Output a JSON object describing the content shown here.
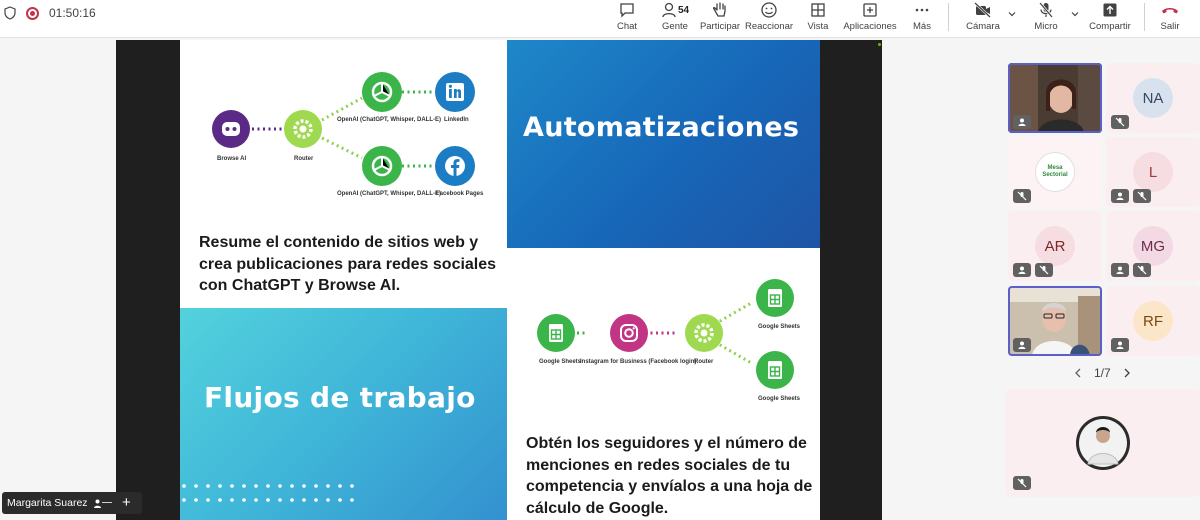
{
  "topbar": {
    "timer": "01:50:16",
    "people_count": "54",
    "buttons": {
      "chat": "Chat",
      "people": "Gente",
      "raise": "Participar",
      "react": "Reaccionar",
      "view": "Vista",
      "apps": "Aplicaciones",
      "more": "Más",
      "camera": "Cámara",
      "mic": "Micro",
      "share": "Compartir",
      "leave": "Salir"
    }
  },
  "slide": {
    "title_auto": "Automatizaciones",
    "title_flujos": "Flujos de trabajo",
    "text_1": "Resume el contenido de sitios web y crea publicaciones para redes sociales con ChatGPT y Browse AI.",
    "text_2": "Obtén los seguidores y el número de menciones en redes sociales de tu competencia y envíalos a una hoja de cálculo de Google.",
    "flow_1": {
      "browse": "Browse AI",
      "router": "Router",
      "openai_top": "OpenAI (ChatGPT, Whisper, DALL-E)",
      "openai_bottom": "OpenAI (ChatGPT, Whisper, DALL-E)",
      "linkedin": "LinkedIn",
      "facebook": "Facebook Pages"
    },
    "flow_2": {
      "sheets_left": "Google Sheets",
      "instagram": "Instagram for Business (Facebook login)",
      "router": "Router",
      "sheets_top": "Google Sheets",
      "sheets_bottom": "Google Sheets"
    }
  },
  "gallery": {
    "initials": [
      "NA",
      "L",
      "AR",
      "MG",
      "RF"
    ],
    "logo_text": "Mesa Sectorial",
    "pager": "1/7"
  },
  "presenter": {
    "name": "Margarita Suarez"
  },
  "colors": {
    "accent": "#5b5fc7",
    "leave": "#c4314b",
    "make_green": "#3bb54a",
    "make_purple": "#6c2bd9"
  }
}
